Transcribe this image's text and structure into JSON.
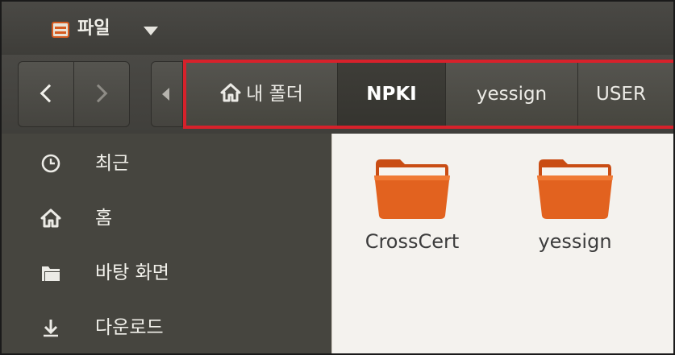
{
  "app": {
    "title": "파일"
  },
  "path": {
    "crumbs": [
      {
        "label": "내 폴더"
      },
      {
        "label": "NPKI"
      },
      {
        "label": "yessign"
      },
      {
        "label": "USER"
      }
    ]
  },
  "sidebar": {
    "items": [
      {
        "label": "최근",
        "icon": "clock-icon"
      },
      {
        "label": "홈",
        "icon": "home-icon"
      },
      {
        "label": "바탕 화면",
        "icon": "folder-icon"
      },
      {
        "label": "다운로드",
        "icon": "download-icon"
      }
    ]
  },
  "content": {
    "folders": [
      {
        "name": "CrossCert"
      },
      {
        "name": "yessign"
      }
    ]
  },
  "colors": {
    "highlight": "#d7212b",
    "folder": "#e2621f",
    "sidebar_bg": "#46453f",
    "content_bg": "#f4f2ee"
  }
}
